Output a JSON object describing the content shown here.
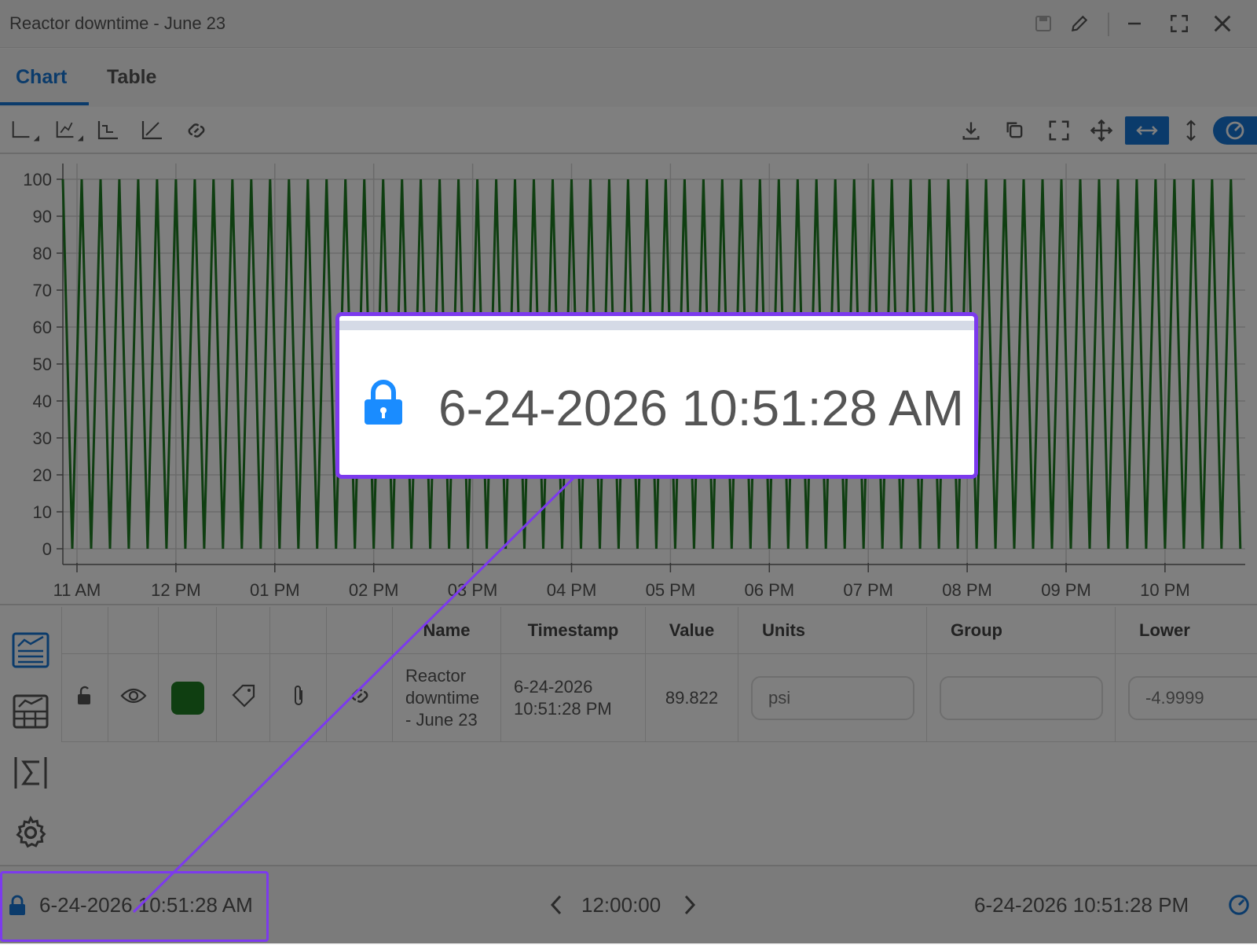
{
  "window": {
    "title": "Reactor downtime - June 23"
  },
  "tabs": [
    {
      "label": "Chart",
      "active": true
    },
    {
      "label": "Table",
      "active": false
    }
  ],
  "chart_data": {
    "type": "line",
    "y_ticks": [
      "100",
      "90",
      "80",
      "70",
      "60",
      "50",
      "40",
      "30",
      "20",
      "10",
      "0"
    ],
    "x_ticks": [
      "11 AM",
      "12 PM",
      "01 PM",
      "02 PM",
      "03 PM",
      "04 PM",
      "05 PM",
      "06 PM",
      "07 PM",
      "08 PM",
      "09 PM",
      "10 PM"
    ],
    "ylim": [
      0,
      100
    ],
    "series": [
      {
        "color": "#1e7d22",
        "pattern": "oscillating between 0 and 100",
        "cycles_per_hour": 5.25
      }
    ],
    "grid": true
  },
  "table": {
    "headers": [
      "Name",
      "Timestamp",
      "Value",
      "Units",
      "Group",
      "Lower"
    ],
    "row": {
      "name_lines": [
        "Reactor",
        "downtime",
        "- June 23"
      ],
      "timestamp_lines": [
        "6-24-2026",
        "10:51:28 PM"
      ],
      "value": "89.822",
      "units": "psi",
      "group": "",
      "lower": "-4.9999",
      "color": "#1e7d22"
    }
  },
  "status": {
    "start": "6-24-2026 10:51:28 AM",
    "duration": "12:00:00",
    "end": "6-24-2026 10:51:28 PM"
  },
  "callout": {
    "text": "6-24-2026 10:51:28 AM"
  },
  "colors": {
    "accent": "#1677d6",
    "highlight": "#7c3aed",
    "series": "#1e7d22"
  }
}
